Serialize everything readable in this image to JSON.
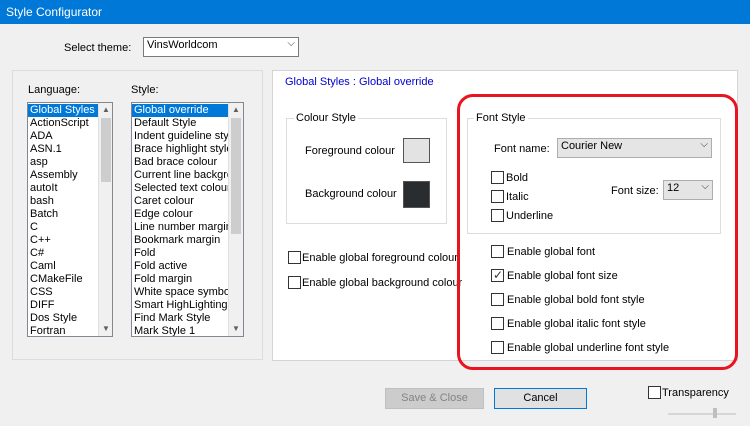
{
  "window": {
    "title": "Style Configurator",
    "close_glyph": "✕"
  },
  "theme": {
    "label": "Select theme:",
    "value": "VinsWorldcom"
  },
  "language": {
    "label": "Language:",
    "items": [
      "Global Styles",
      "ActionScript",
      "ADA",
      "ASN.1",
      "asp",
      "Assembly",
      "autoIt",
      "bash",
      "Batch",
      "C",
      "C++",
      "C#",
      "Caml",
      "CMakeFile",
      "CSS",
      "DIFF",
      "Dos Style",
      "Fortran"
    ],
    "selected_index": 0
  },
  "style": {
    "label": "Style:",
    "items": [
      "Global override",
      "Default Style",
      "Indent guideline style",
      "Brace highlight style",
      "Bad brace colour",
      "Current line background",
      "Selected text colour",
      "Caret colour",
      "Edge colour",
      "Line number margin",
      "Bookmark margin",
      "Fold",
      "Fold active",
      "Fold margin",
      "White space symbol",
      "Smart HighLighting",
      "Find Mark Style",
      "Mark Style 1"
    ],
    "selected_index": 0
  },
  "breadcrumb": "Global Styles : Global override",
  "colour_style": {
    "title": "Colour Style",
    "foreground_label": "Foreground colour",
    "background_label": "Background colour",
    "foreground_color": "#e3e3e3",
    "background_color": "#2a2d30"
  },
  "global_colour": {
    "fg_label": "Enable global foreground colour",
    "bg_label": "Enable global background colour",
    "fg_checked": false,
    "bg_checked": false
  },
  "font_style": {
    "title": "Font Style",
    "font_name_label": "Font name:",
    "font_name_value": "Courier New",
    "font_size_label": "Font size:",
    "font_size_value": "12",
    "bold_label": "Bold",
    "italic_label": "Italic",
    "underline_label": "Underline",
    "bold_checked": false,
    "italic_checked": false,
    "underline_checked": false
  },
  "global_font": {
    "font_label": "Enable global font",
    "size_label": "Enable global font size",
    "bold_label": "Enable global bold font style",
    "italic_label": "Enable global italic font style",
    "underline_label": "Enable global underline font style",
    "font_checked": false,
    "size_checked": true,
    "bold_checked": false,
    "italic_checked": false,
    "underline_checked": false
  },
  "buttons": {
    "save_close": "Save & Close",
    "cancel": "Cancel"
  },
  "transparency": {
    "label": "Transparency",
    "checked": false
  },
  "glyphs": {
    "dropdown": "⌵",
    "scroll_up": "▲",
    "scroll_down": "▼",
    "check": "✓"
  },
  "highlight_color": "#e8141e",
  "accent_color": "#0078d7"
}
